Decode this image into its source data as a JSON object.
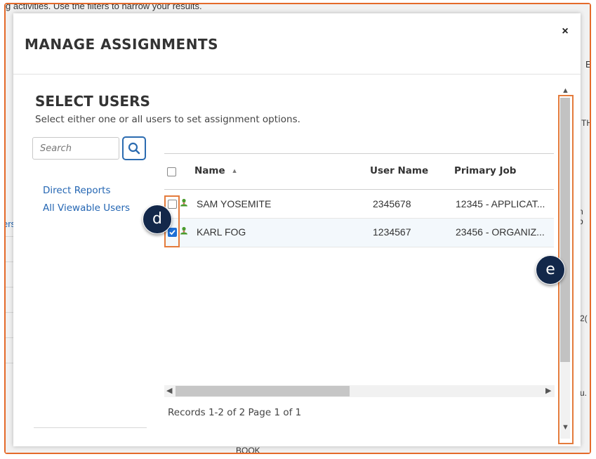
{
  "modal": {
    "title": "MANAGE ASSIGNMENTS",
    "close_label": "×"
  },
  "select_users": {
    "title": "SELECT USERS",
    "subtitle": "Select either one or all users to set assignment options.",
    "search_placeholder": "Search"
  },
  "nav": {
    "items": [
      {
        "label": "Direct Reports"
      },
      {
        "label": "All Viewable Users"
      }
    ]
  },
  "grid": {
    "columns": [
      "Name",
      "User Name",
      "Primary Job"
    ],
    "sort_indicator": "▲",
    "rows": [
      {
        "name": "SAM YOSEMITE",
        "user_name": "2345678",
        "primary_job": "12345 -   APPLICAT...",
        "checked": false
      },
      {
        "name": "KARL FOG",
        "user_name": "1234567",
        "primary_job": "23456   - ORGANIZ...",
        "checked": true
      }
    ],
    "records": "Records 1-2 of 2   Page 1 of 1"
  },
  "callouts": {
    "d": "d",
    "e": "e"
  },
  "background": {
    "top_text": "g activities. Use the filters to narrow your results.",
    "left_text": "ers",
    "bottom_text": "BOOK",
    "right_fragments": [
      "E",
      "TH",
      "n b",
      "2(",
      "u."
    ]
  },
  "colors": {
    "accent": "#2466b3",
    "highlight": "#e47b3c",
    "callout": "#13284a",
    "checkbox": "#1d6fd6",
    "user_icon": "#4a9a2c"
  },
  "icons": {
    "search": "search-icon",
    "user": "user-icon",
    "close": "close-icon"
  }
}
